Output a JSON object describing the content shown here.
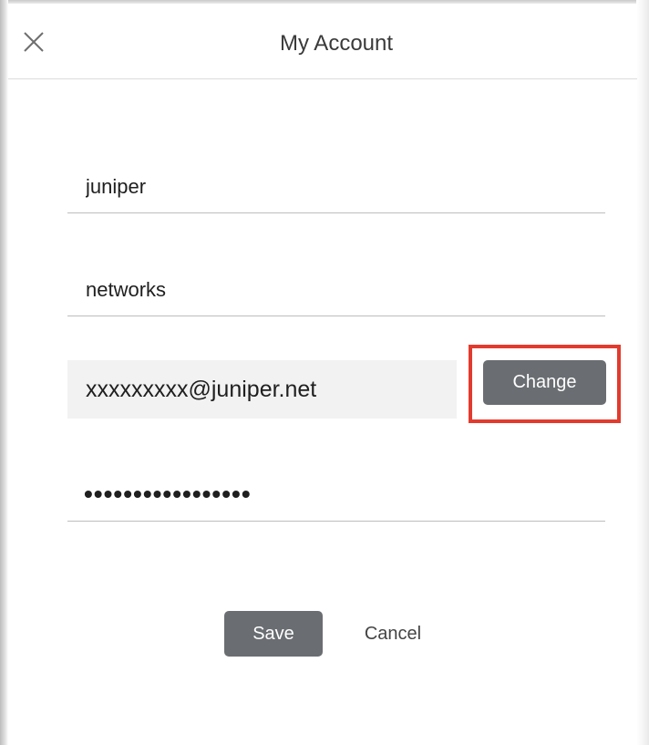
{
  "dialog": {
    "title": "My Account",
    "close_icon": "close-icon"
  },
  "form": {
    "first_name": "juniper",
    "last_name": "networks",
    "email": "xxxxxxxxx@juniper.net",
    "change_label": "Change",
    "password_masked": "•••••••••••••••••"
  },
  "actions": {
    "save_label": "Save",
    "cancel_label": "Cancel"
  },
  "colors": {
    "button_bg": "#6a6d71",
    "highlight": "#e23b2e",
    "email_bg": "#f2f2f2"
  }
}
